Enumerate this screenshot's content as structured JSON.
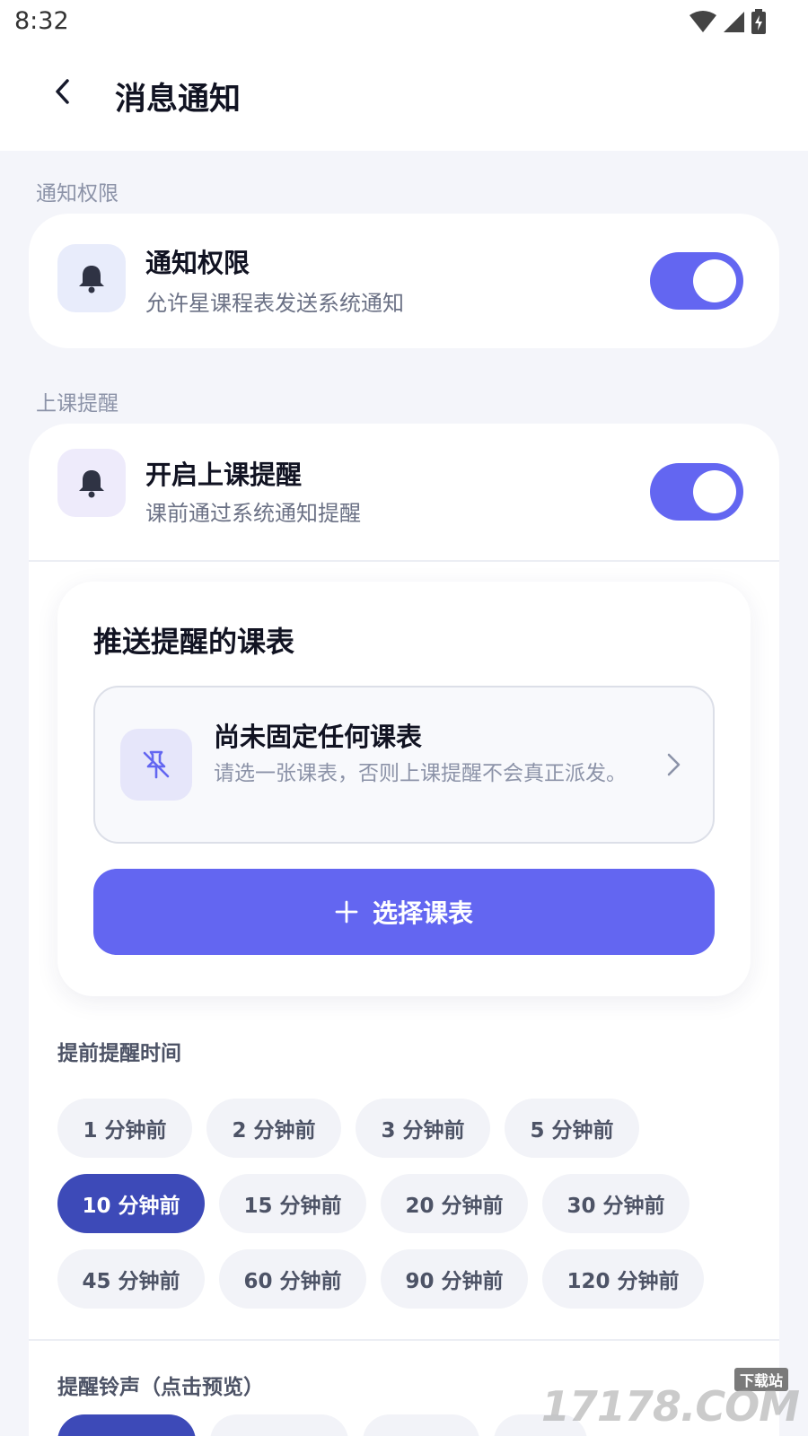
{
  "status": {
    "time": "8:32"
  },
  "header": {
    "title": "消息通知"
  },
  "sections": {
    "notify_label": "通知权限",
    "class_label": "上课提醒"
  },
  "notify": {
    "title": "通知权限",
    "subtitle": "允许星课程表发送系统通知",
    "enabled": true
  },
  "reminder": {
    "title": "开启上课提醒",
    "subtitle": "课前通过系统通知提醒",
    "enabled": true
  },
  "push": {
    "title": "推送提醒的课表",
    "empty_title": "尚未固定任何课表",
    "empty_subtitle": "请选一张课表，否则上课提醒不会真正派发。",
    "button_label": "选择课表"
  },
  "advance": {
    "label": "提前提醒时间",
    "selected": "10 分钟前",
    "options": [
      "1 分钟前",
      "2 分钟前",
      "3 分钟前",
      "5 分钟前",
      "10 分钟前",
      "15 分钟前",
      "20 分钟前",
      "30 分钟前",
      "45 分钟前",
      "60 分钟前",
      "90 分钟前",
      "120 分钟前"
    ]
  },
  "ringtone": {
    "label": "提醒铃声（点击预览）"
  },
  "watermark": {
    "text": "17178.COM",
    "tag": "下载站"
  },
  "colors": {
    "accent": "#6366f1",
    "selected_chip": "#3d4ab8",
    "background": "#f4f5fa"
  },
  "icons": {
    "bell": "bell-icon",
    "pin_off": "pin-off-icon",
    "plus": "plus-icon",
    "back": "chevron-left-icon",
    "chevron": "chevron-right-icon"
  }
}
